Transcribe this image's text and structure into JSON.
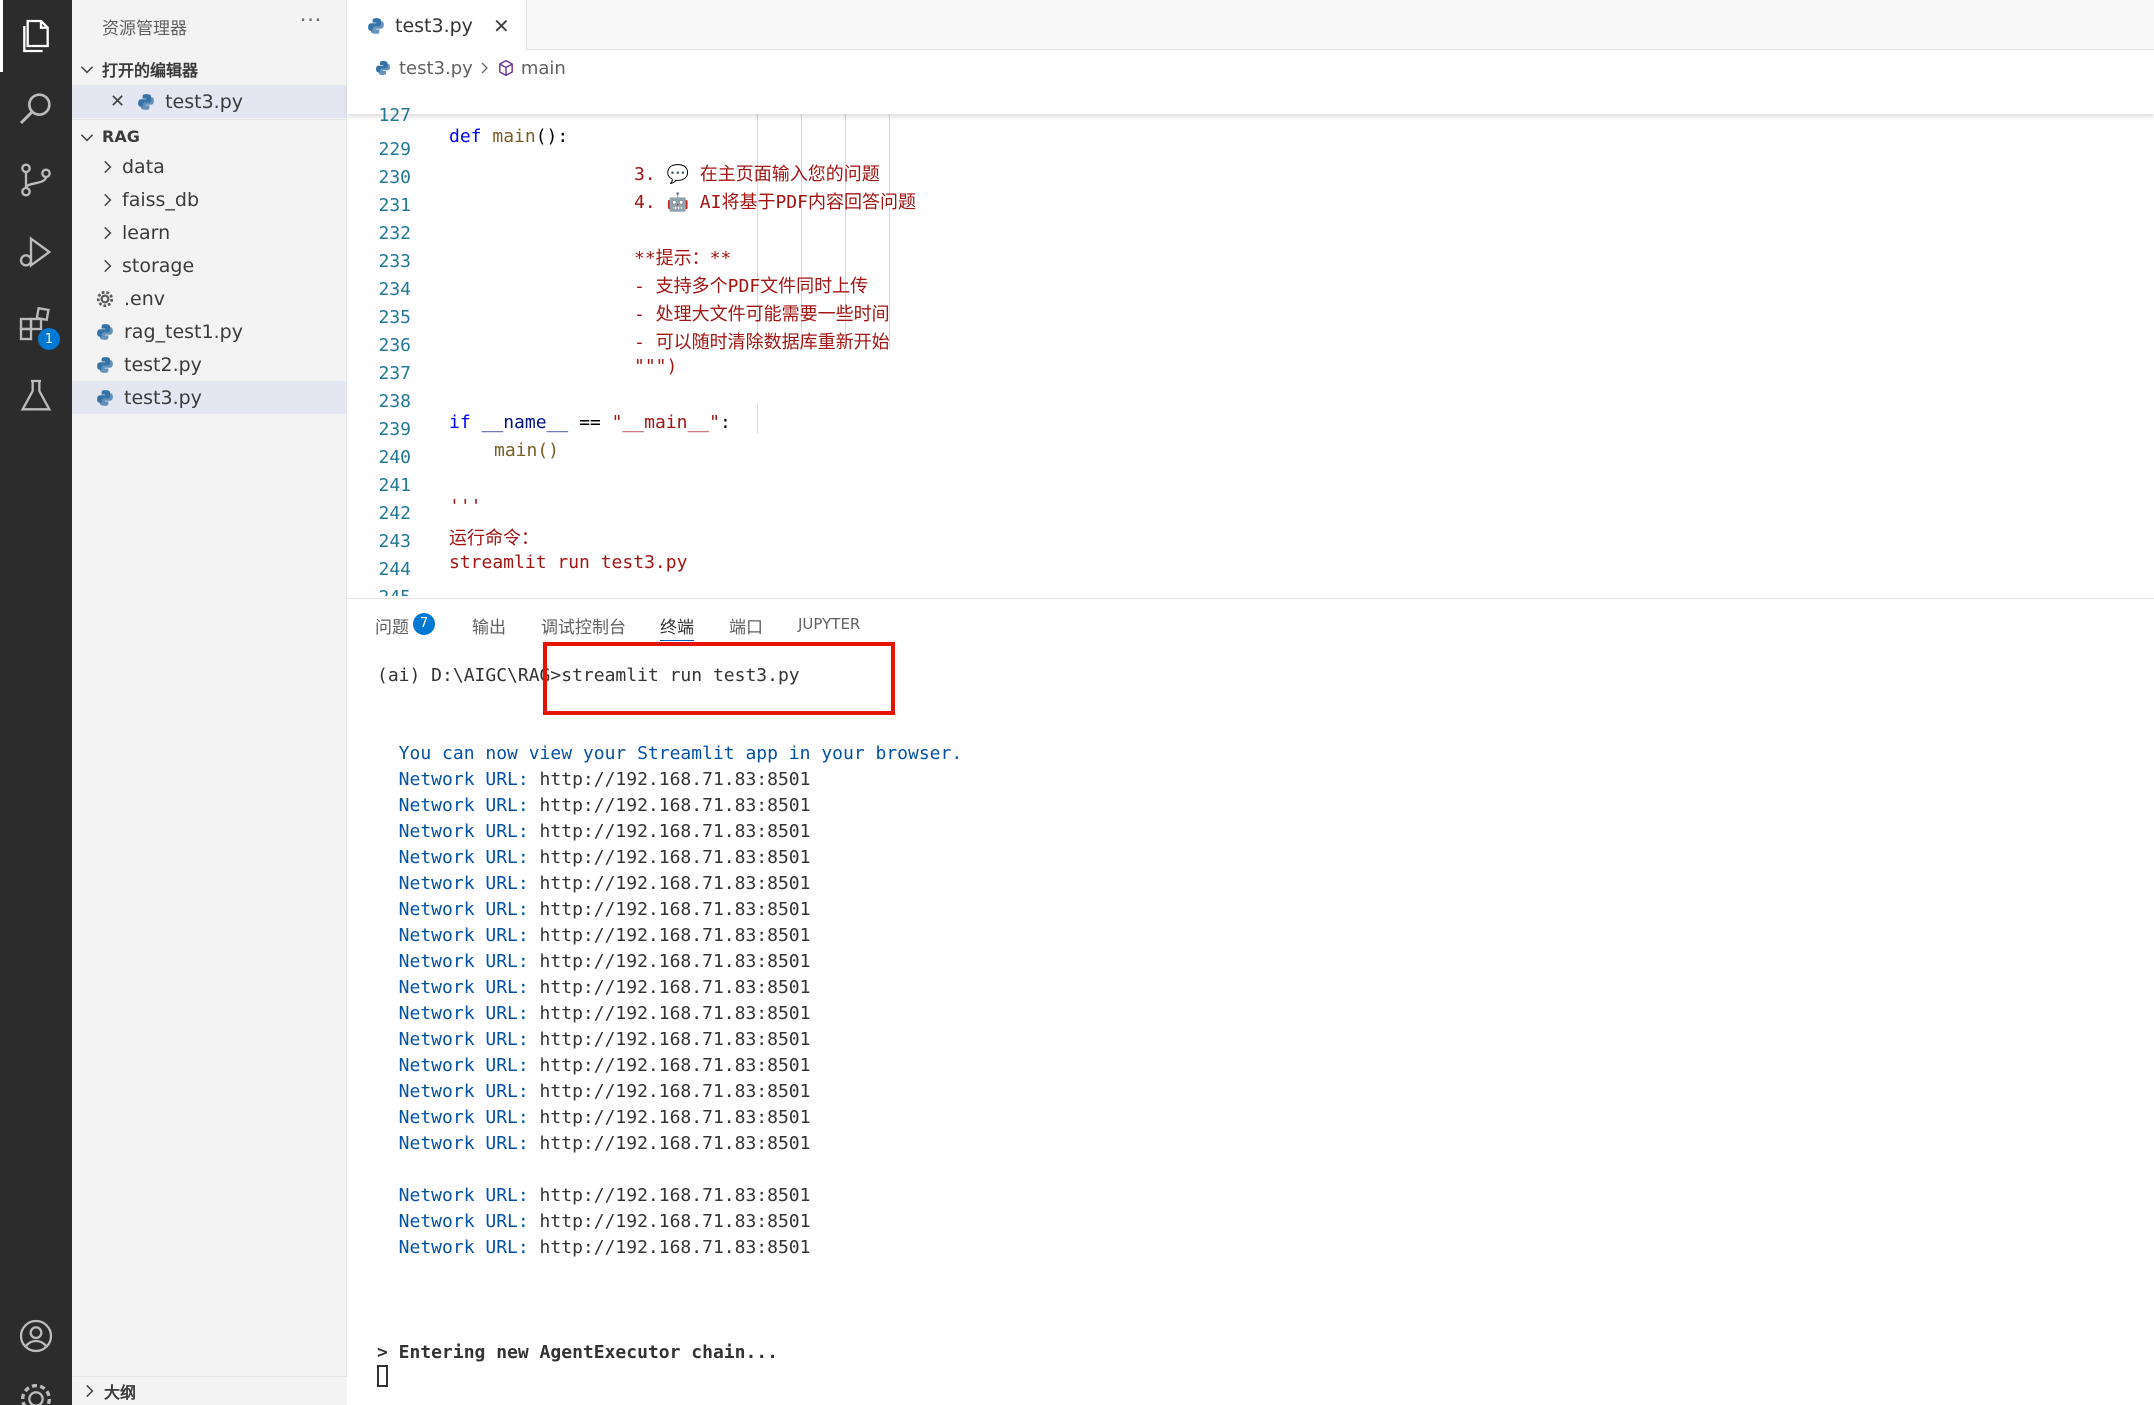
{
  "activity_bar": {
    "items": [
      {
        "icon": "files-icon"
      },
      {
        "icon": "search-icon"
      },
      {
        "icon": "source-control-icon"
      },
      {
        "icon": "run-debug-icon"
      },
      {
        "icon": "extensions-icon",
        "badge": "1"
      },
      {
        "icon": "testing-icon"
      }
    ],
    "bottom": [
      {
        "icon": "account-icon"
      },
      {
        "icon": "settings-gear-icon"
      }
    ]
  },
  "sidebar": {
    "title": "资源管理器",
    "more": "···",
    "open_editors_label": "打开的编辑器",
    "open_editor_file": "test3.py",
    "folder_label": "RAG",
    "items": [
      {
        "label": "data",
        "kind": "folder"
      },
      {
        "label": "faiss_db",
        "kind": "folder"
      },
      {
        "label": "learn",
        "kind": "folder"
      },
      {
        "label": "storage",
        "kind": "folder"
      },
      {
        "label": ".env",
        "kind": "gear"
      },
      {
        "label": "rag_test1.py",
        "kind": "py"
      },
      {
        "label": "test2.py",
        "kind": "py"
      },
      {
        "label": "test3.py",
        "kind": "py"
      }
    ],
    "outline_label": "大纲"
  },
  "editor": {
    "tab_label": "test3.py",
    "close_glyph": "✕",
    "breadcrumb_file": "test3.py",
    "breadcrumb_symbol": "main",
    "sticky_line_number": "127",
    "sticky_def": "def",
    "sticky_fn": "main",
    "sticky_rest": "():",
    "lines": [
      {
        "n": "229",
        "num": "3.",
        "emoji": "💬",
        "text": "在主页面输入您的问题"
      },
      {
        "n": "230",
        "num": "4.",
        "emoji": "🤖",
        "text": "AI将基于PDF内容回答问题"
      },
      {
        "n": "231",
        "text": ""
      },
      {
        "n": "232",
        "text": "**提示：**"
      },
      {
        "n": "233",
        "text": "- 支持多个PDF文件同时上传"
      },
      {
        "n": "234",
        "text": "- 处理大文件可能需要一些时间"
      },
      {
        "n": "235",
        "text": "- 可以随时清除数据库重新开始"
      },
      {
        "n": "236",
        "text": "\"\"\")"
      },
      {
        "n": "237",
        "text": ""
      },
      {
        "n": "238",
        "text": ""
      },
      {
        "n": "239",
        "text": "main()"
      },
      {
        "n": "240",
        "text": ""
      },
      {
        "n": "241",
        "text": "'''"
      },
      {
        "n": "242",
        "text": "运行命令："
      },
      {
        "n": "243",
        "text": "streamlit run test3.py"
      },
      {
        "n": "244",
        "text": ""
      },
      {
        "n": "245",
        "text": "'''"
      }
    ],
    "line238": {
      "kw": "if",
      "var": "__name__",
      "op": " == ",
      "str": "\"__main__\"",
      "end": ":"
    }
  },
  "panel": {
    "tabs": [
      {
        "label": "问题",
        "badge": "7"
      },
      {
        "label": "输出"
      },
      {
        "label": "调试控制台"
      },
      {
        "label": "终端",
        "active": true
      },
      {
        "label": "端口"
      },
      {
        "label": "JUPYTER"
      }
    ],
    "prompt": "(ai) D:\\AIGC\\RAG>streamlit run test3.py",
    "view_msg": "  You can now view your Streamlit app in your browser.",
    "network_label": "  Network URL:",
    "network_url": " http://192.168.71.83:8501",
    "network_count_block1": 16,
    "network_count_block2": 3,
    "agent_line": "> Entering new AgentExecutor chain..."
  },
  "colors": {
    "activity_bg": "#2c2c2c",
    "sidebar_bg": "#f3f3f3",
    "accent": "#0078d4",
    "highlight_box": "#e51400"
  }
}
